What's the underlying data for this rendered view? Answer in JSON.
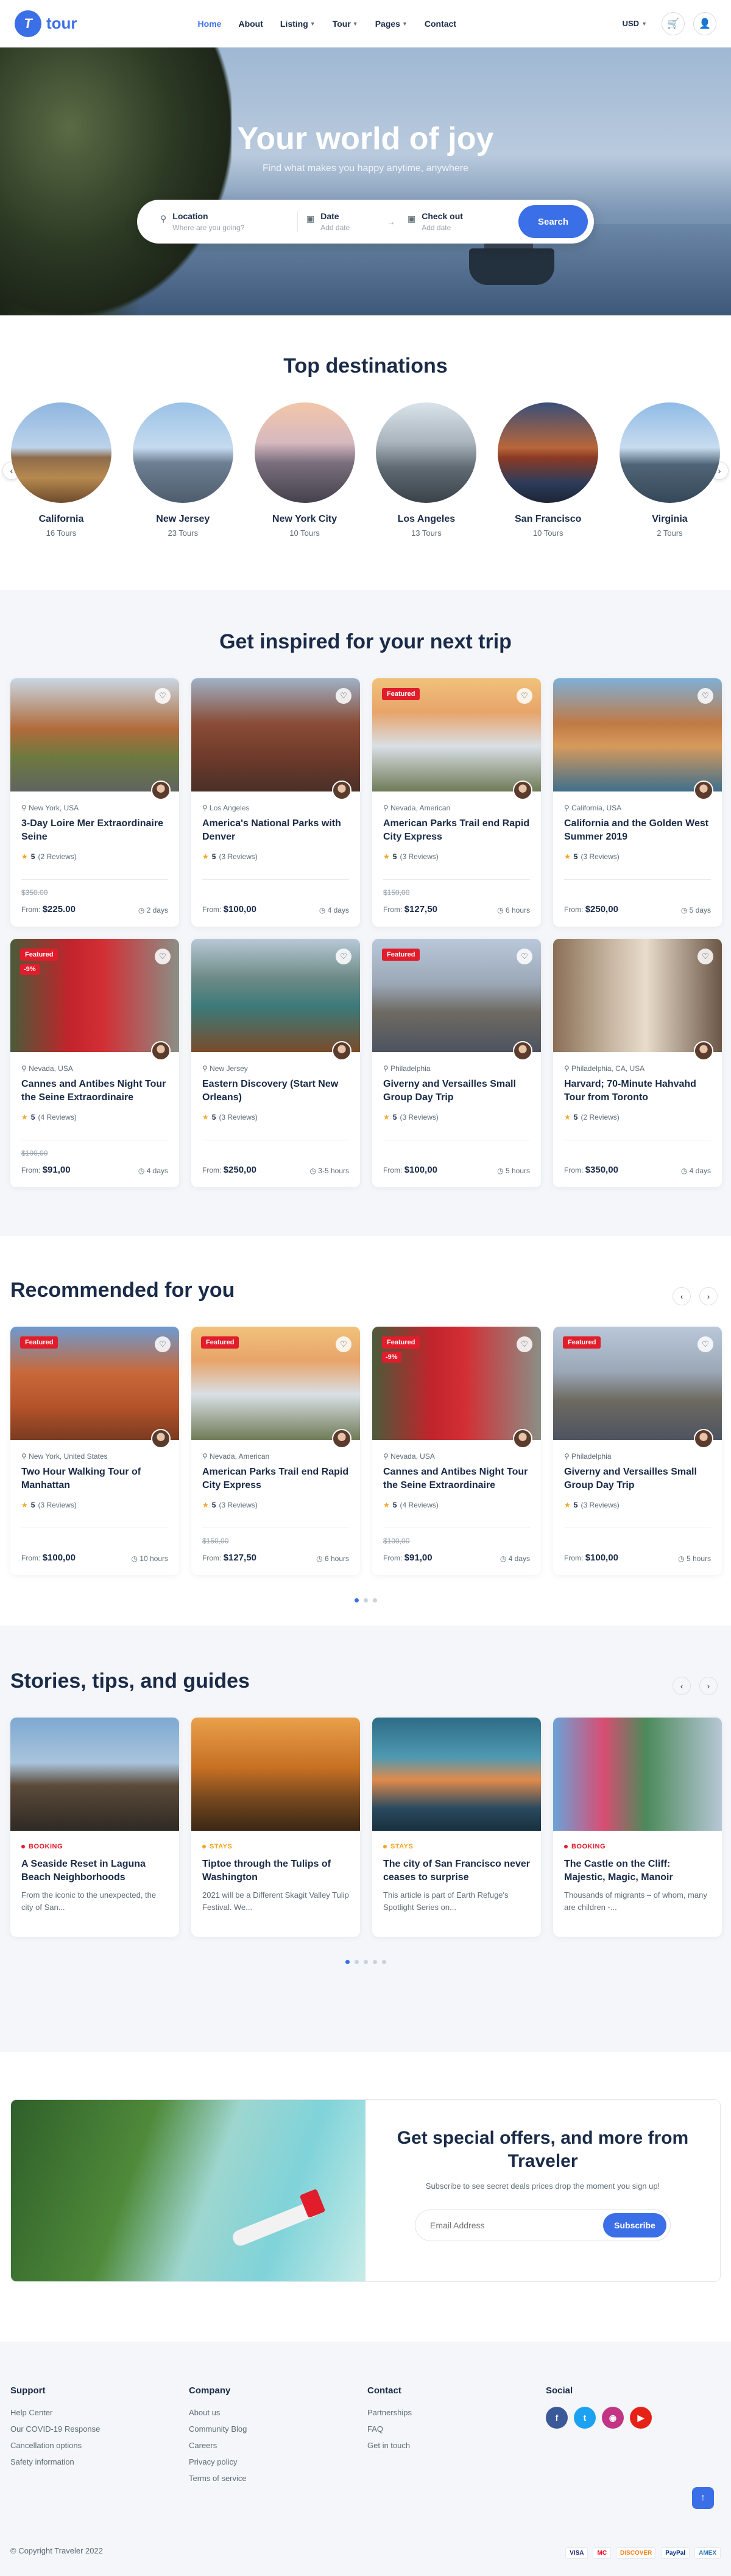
{
  "header": {
    "logo_text": "tour",
    "nav": [
      {
        "label": "Home",
        "caret": false
      },
      {
        "label": "About",
        "caret": false
      },
      {
        "label": "Listing",
        "caret": true
      },
      {
        "label": "Tour",
        "caret": true
      },
      {
        "label": "Pages",
        "caret": true
      },
      {
        "label": "Contact",
        "caret": false
      }
    ],
    "currency": "USD"
  },
  "hero": {
    "title": "Your world of joy",
    "subtitle": "Find what makes you happy anytime, anywhere",
    "location_label": "Location",
    "location_placeholder": "Where are you going?",
    "date_label": "Date",
    "date_value": "Add date",
    "checkout_label": "Check out",
    "checkout_value": "Add date",
    "search_label": "Search"
  },
  "destinations": {
    "title": "Top destinations",
    "items": [
      {
        "name": "California",
        "tours": "16 Tours"
      },
      {
        "name": "New Jersey",
        "tours": "23 Tours"
      },
      {
        "name": "New York City",
        "tours": "10 Tours"
      },
      {
        "name": "Los Angeles",
        "tours": "13 Tours"
      },
      {
        "name": "San Francisco",
        "tours": "10 Tours"
      },
      {
        "name": "Virginia",
        "tours": "2 Tours"
      }
    ]
  },
  "inspired": {
    "title": "Get inspired for your next trip",
    "cards": [
      {
        "featured": "",
        "discount": "",
        "location": "New York, USA",
        "title": "3-Day Loire Mer Extraordinaire Seine",
        "rating": "5",
        "reviews": "(2 Reviews)",
        "old_price": "$350.00",
        "from": "From:",
        "price": "$225.00",
        "duration": "2 days"
      },
      {
        "featured": "",
        "discount": "",
        "location": "Los Angeles",
        "title": "America's National Parks with Denver",
        "rating": "5",
        "reviews": "(3 Reviews)",
        "old_price": "",
        "from": "From:",
        "price": "$100,00",
        "duration": "4 days"
      },
      {
        "featured": "Featured",
        "discount": "",
        "location": "Nevada, American",
        "title": "American Parks Trail end Rapid City Express",
        "rating": "5",
        "reviews": "(3 Reviews)",
        "old_price": "$150,00",
        "from": "From:",
        "price": "$127,50",
        "duration": "6 hours"
      },
      {
        "featured": "",
        "discount": "",
        "location": "California, USA",
        "title": "California and the Golden West Summer 2019",
        "rating": "5",
        "reviews": "(3 Reviews)",
        "old_price": "",
        "from": "From:",
        "price": "$250,00",
        "duration": "5 days"
      },
      {
        "featured": "Featured",
        "discount": "-9%",
        "location": "Nevada, USA",
        "title": "Cannes and Antibes Night Tour the Seine Extraordinaire",
        "rating": "5",
        "reviews": "(4 Reviews)",
        "old_price": "$100,00",
        "from": "From:",
        "price": "$91,00",
        "duration": "4 days"
      },
      {
        "featured": "",
        "discount": "",
        "location": "New Jersey",
        "title": "Eastern Discovery (Start New Orleans)",
        "rating": "5",
        "reviews": "(3 Reviews)",
        "old_price": "",
        "from": "From:",
        "price": "$250,00",
        "duration": "3-5 hours"
      },
      {
        "featured": "Featured",
        "discount": "",
        "location": "Philadelphia",
        "title": "Giverny and Versailles Small Group Day Trip",
        "rating": "5",
        "reviews": "(3 Reviews)",
        "old_price": "",
        "from": "From:",
        "price": "$100,00",
        "duration": "5 hours"
      },
      {
        "featured": "",
        "discount": "",
        "location": "Philadelphia, CA, USA",
        "title": "Harvard; 70-Minute Hahvahd Tour from Toronto",
        "rating": "5",
        "reviews": "(2 Reviews)",
        "old_price": "",
        "from": "From:",
        "price": "$350,00",
        "duration": "4 days"
      }
    ]
  },
  "recommended": {
    "title": "Recommended for you",
    "cards": [
      {
        "featured": "Featured",
        "discount": "",
        "location": "New York, United States",
        "title": "Two Hour Walking Tour of Manhattan",
        "rating": "5",
        "reviews": "(3 Reviews)",
        "old_price": "",
        "from": "From:",
        "price": "$100,00",
        "duration": "10 hours"
      },
      {
        "featured": "Featured",
        "discount": "",
        "location": "Nevada, American",
        "title": "American Parks Trail end Rapid City Express",
        "rating": "5",
        "reviews": "(3 Reviews)",
        "old_price": "$150,00",
        "from": "From:",
        "price": "$127,50",
        "duration": "6 hours"
      },
      {
        "featured": "Featured",
        "discount": "-9%",
        "location": "Nevada, USA",
        "title": "Cannes and Antibes Night Tour the Seine Extraordinaire",
        "rating": "5",
        "reviews": "(4 Reviews)",
        "old_price": "$100,00",
        "from": "From:",
        "price": "$91,00",
        "duration": "4 days"
      },
      {
        "featured": "Featured",
        "discount": "",
        "location": "Philadelphia",
        "title": "Giverny and Versailles Small Group Day Trip",
        "rating": "5",
        "reviews": "(3 Reviews)",
        "old_price": "",
        "from": "From:",
        "price": "$100,00",
        "duration": "5 hours"
      }
    ]
  },
  "stories": {
    "title": "Stories, tips, and guides",
    "items": [
      {
        "category": "BOOKING",
        "color": "#e11d2b",
        "title": "A Seaside Reset in Laguna Beach Neighborhoods",
        "desc": "From the iconic to the unexpected, the city of San..."
      },
      {
        "category": "STAYS",
        "color": "#f5a524",
        "title": "Tiptoe through the Tulips of Washington",
        "desc": "2021 will be a Different Skagit Valley Tulip Festival. We..."
      },
      {
        "category": "STAYS",
        "color": "#f5a524",
        "title": "The city of San Francisco never ceases to surprise",
        "desc": "This article is part of Earth Refuge's Spotlight Series on..."
      },
      {
        "category": "BOOKING",
        "color": "#e11d2b",
        "title": "The Castle on the Cliff: Majestic, Magic, Manoir",
        "desc": "Thousands of migrants – of whom, many are children -..."
      }
    ]
  },
  "newsletter": {
    "title": "Get special offers, and more from Traveler",
    "subtitle": "Subscribe to see secret deals prices drop the moment you sign up!",
    "placeholder": "Email Address",
    "button": "Subscribe"
  },
  "footer": {
    "support_title": "Support",
    "support": [
      "Help Center",
      "Our COVID-19 Response",
      "Cancellation options",
      "Safety information"
    ],
    "company_title": "Company",
    "company": [
      "About us",
      "Community Blog",
      "Careers",
      "Privacy policy",
      "Terms of service"
    ],
    "contact_title": "Contact",
    "contact": [
      "Partnerships",
      "FAQ",
      "Get in touch"
    ],
    "social_title": "Social",
    "copyright": "© Copyright Traveler 2022",
    "payments": [
      "VISA",
      "MC",
      "DISCOVER",
      "PayPal",
      "AMEX"
    ]
  }
}
